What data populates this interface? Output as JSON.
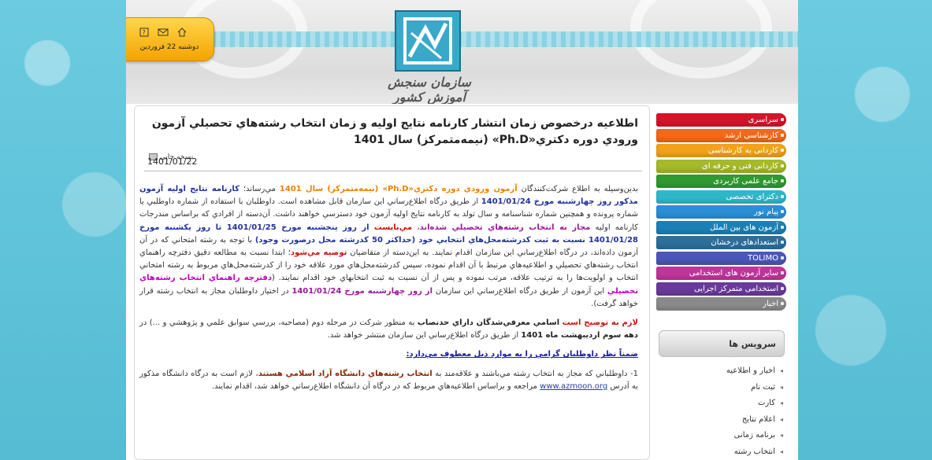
{
  "header": {
    "logo_caption": "سازمان سنجش آموزش کشور",
    "date": "دوشنبه 22 فروردین",
    "icons": [
      "home-icon",
      "mail-icon",
      "help-icon"
    ]
  },
  "menu": {
    "items": [
      {
        "label": "سراسری",
        "color": "#d4142a"
      },
      {
        "label": "کارشناسی ارشد",
        "color": "#ef6a1c"
      },
      {
        "label": "کاردانی به کارشناسی",
        "color": "#f0a21c"
      },
      {
        "label": "کاردانی فنی و حرفه ای",
        "color": "#a6b82b"
      },
      {
        "label": "جامع علمی کاربردی",
        "color": "#2f9a2f"
      },
      {
        "label": "دکترای تخصصی",
        "color": "#2fb7c9"
      },
      {
        "label": "پیام نور",
        "color": "#2a8fd6"
      },
      {
        "label": "آزمون های بین الملل",
        "color": "#1c7fb5"
      },
      {
        "label": "استعدادهای درخشان",
        "color": "#2c6f9a"
      },
      {
        "label": "TOLIMO",
        "color": "#4a57b8"
      },
      {
        "label": "سایر آزمون های استخدامی",
        "color": "#c0359a"
      },
      {
        "label": "استخدامی متمرکز اجرایی",
        "color": "#6a3a9a"
      },
      {
        "label": "اخبار",
        "color": "#8a8a8a"
      }
    ]
  },
  "service": {
    "title": "سرویس ها",
    "items": [
      "اخبار و اطلاعیه",
      "ثبت نام",
      "کارت",
      "اعلام نتایج",
      "برنامه زمانی",
      "انتخاب رشته"
    ]
  },
  "article": {
    "title": "اطلاعیه درخصوص زمان انتشار کارنامه نتايج اوليه و زمان انتخاب رشته‌هاي تحصيلي آزمون ورودي دوره دكتري«Ph.D» (نيمه‌متمركز) سال 1401",
    "print_label": "نسخه چاپی",
    "date": "1401/01/22",
    "p1": {
      "t1": "بدين‌وسيله به اطلاع شركت‌كنندگان ",
      "t2": "آزمون ورودي دوره دكتري«Ph.D» (نيمه‌متمركز) سال 1401",
      "t3": " مي‌رساند؛ ",
      "t4": "كارنامه نتايج اوليه آزمون مذكور روز چهارشنبه مورخ 1401/01/24",
      "t5": " از طريق درگاه اطلاع‌رساني اين سازمان قابل مشاهده است. داوطلبان با استفاده از شماره داوطلبي يا شماره پرونده و همچنين شماره شناسنامه و سال تولد به كارنامه نتايج اوليه آزمون خود دسترسي خواهند داشت. آن‌دسته از افرادي كه براساس مندرجات كارنامه اوليه ",
      "t6": "مجاز به انتخاب رشته‌هاي تحصيلي شده‌اند",
      "t7": "، ",
      "t8": "مي‌بايست",
      "t9": " ",
      "t10": "از روز پنجشنبه مورخ 1401/01/25 تا روز يكشنبه مورخ 1401/01/28 نسبت به ثبت كدرشته‌محل‌هاي انتخابي خود (حداكثر 50 كدرشته محل درصورت وجود)",
      "t11": " با توجه به رشته امتحاني كه در آن آزمون داده‌اند، در درگاه اطلاع‌رساني اين سازمان اقدام نمايند. به اين‌دسته از متقاضيان ",
      "t12": "توصيه مي‌شود",
      "t13": "؛ ابتدا نسبت به مطالعه دقيق دفترچه راهنماي انتخاب رشته‌هاي تحصيلي و اطلاعيه‌هاي مرتبط با آن اقدام نموده، سپس كدرشته‌محل‌هاي مورد علاقه خود را از كدرشته‌محل‌هاي مربوط به رشته امتحاني انتخاب و اولويت‌ها را به ترتيب علاقه، مرتب نموده و پس از آن نسبت به ثبت انتخابهاي خود اقدام نمايند. (",
      "t14": "دفترچه راهنماي انتخاب رشته‌هاي تحصيلي",
      "t15": " اين آزمون از طريق درگاه اطلاع‌رساني اين سازمان ",
      "t16": "از روز چهارشنبه مورخ 1401/01/24",
      "t17": " در اختيار داوطلبان مجاز به انتخاب رشته قرار خواهد گرفت)."
    },
    "p2": {
      "t1": "لازم به توضيح است",
      "t2": " ",
      "t3": "اسامي معرفي‌شدگان داراي حدنصاب",
      "t4": " به منظور شركت در مرحله دوم (مصاحبه، بررسي سوابق علمي و پژوهشي و ...) در ",
      "t5": "دهه سوم ارديبهشت ماه 1401",
      "t6": " از طريق درگاه اطلاع‌رساني اين سازمان منتشر خواهد شد."
    },
    "p3": "ضمناً نظر داوطلبان گرامي را به موارد ذيل معطوف مي‌دارد:",
    "p4": {
      "t1": "1- داوطلباني كه مجاز به انتخاب رشته مي‌باشند و علاقه‌مند به ",
      "t2": "انتخاب رشته‌هاي دانشگاه آزاد اسلامي هستند",
      "t3": "، لازم است به درگاه دانشگاه مذكور به آدرس ",
      "t4": "www.azmoon.org",
      "t5": " مراجعه و براساس اطلاعيه‌هاي مربوط كه در درگاه آن دانشگاه اطلاع‌رساني خواهد شد، اقدام نمايند."
    }
  }
}
